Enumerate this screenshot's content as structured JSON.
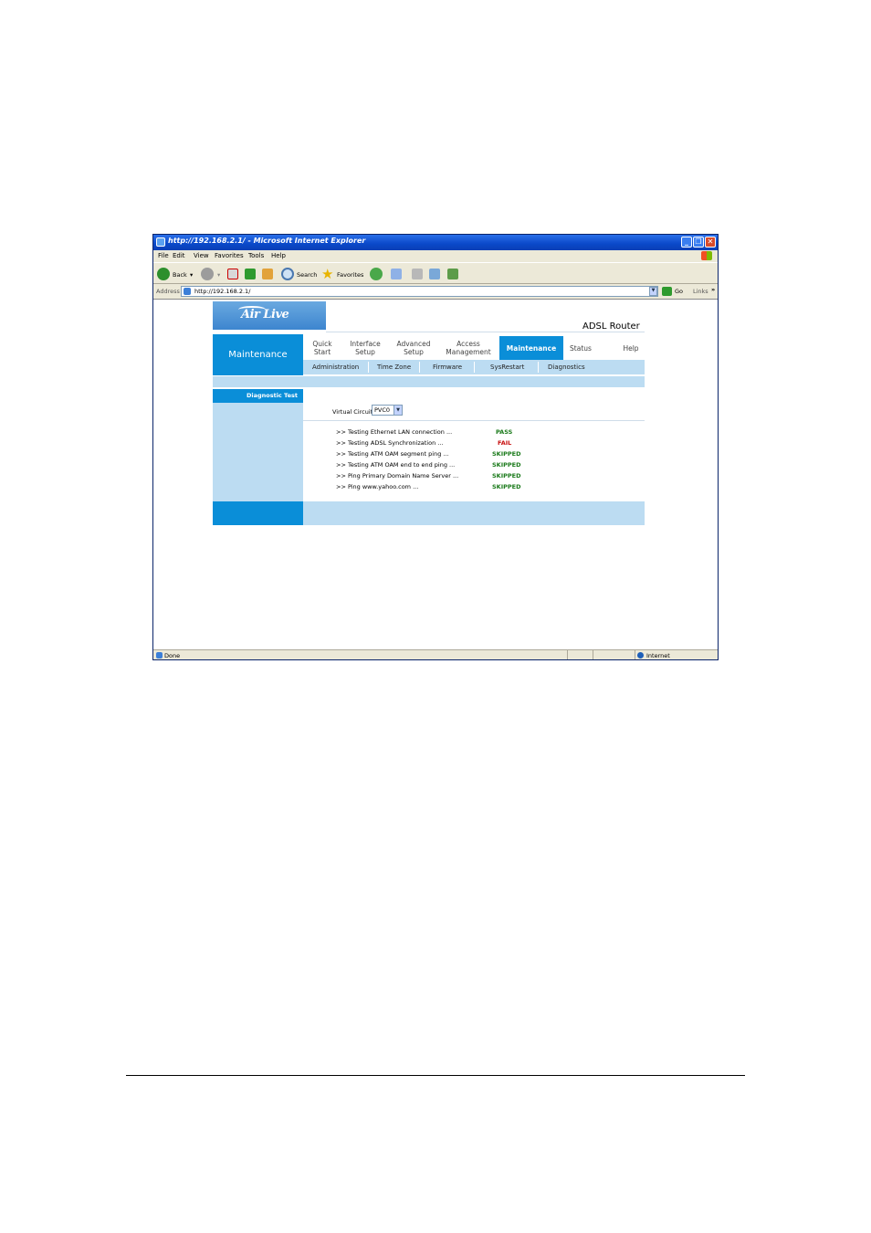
{
  "browser": {
    "title": "http://192.168.2.1/ - Microsoft Internet Explorer",
    "menu": [
      "File",
      "Edit",
      "View",
      "Favorites",
      "Tools",
      "Help"
    ],
    "toolbar": {
      "back_label": "Back",
      "search_label": "Search",
      "favorites_label": "Favorites"
    },
    "address": {
      "label": "Address",
      "url": "http://192.168.2.1/",
      "go_label": "Go",
      "links_label": "Links"
    },
    "status": {
      "text": "Done",
      "zone": "Internet"
    }
  },
  "router": {
    "logo": "Air Live",
    "product": "ADSL Router",
    "section": "Maintenance",
    "tabs": [
      {
        "label": "Quick Start"
      },
      {
        "label": "Interface Setup"
      },
      {
        "label": "Advanced Setup"
      },
      {
        "label": "Access Management"
      },
      {
        "label": "Maintenance"
      },
      {
        "label": "Status"
      },
      {
        "label": "Help"
      }
    ],
    "subtabs": [
      "Administration",
      "Time Zone",
      "Firmware",
      "SysRestart",
      "Diagnostics"
    ],
    "sidebar_heading": "Diagnostic Test",
    "virtual_circuit": {
      "label": "Virtual Circuit",
      "value": "PVC0"
    },
    "tests": [
      {
        "label": ">> Testing Ethernet LAN connection ...",
        "result": "PASS"
      },
      {
        "label": ">> Testing ADSL Synchronization ...",
        "result": "FAIL"
      },
      {
        "label": ">> Testing ATM OAM segment ping ...",
        "result": "SKIPPED"
      },
      {
        "label": ">> Testing ATM OAM end to end ping ...",
        "result": "SKIPPED"
      },
      {
        "label": ">> Ping Primary Domain Name Server ...",
        "result": "SKIPPED"
      },
      {
        "label": ">> Ping www.yahoo.com ...",
        "result": "SKIPPED"
      }
    ]
  },
  "colors": {
    "accent": "#0a8ed8",
    "light": "#bcdcf2",
    "pass": "#1a7a1a",
    "fail": "#c81010",
    "skipped": "#1a7a1a"
  }
}
